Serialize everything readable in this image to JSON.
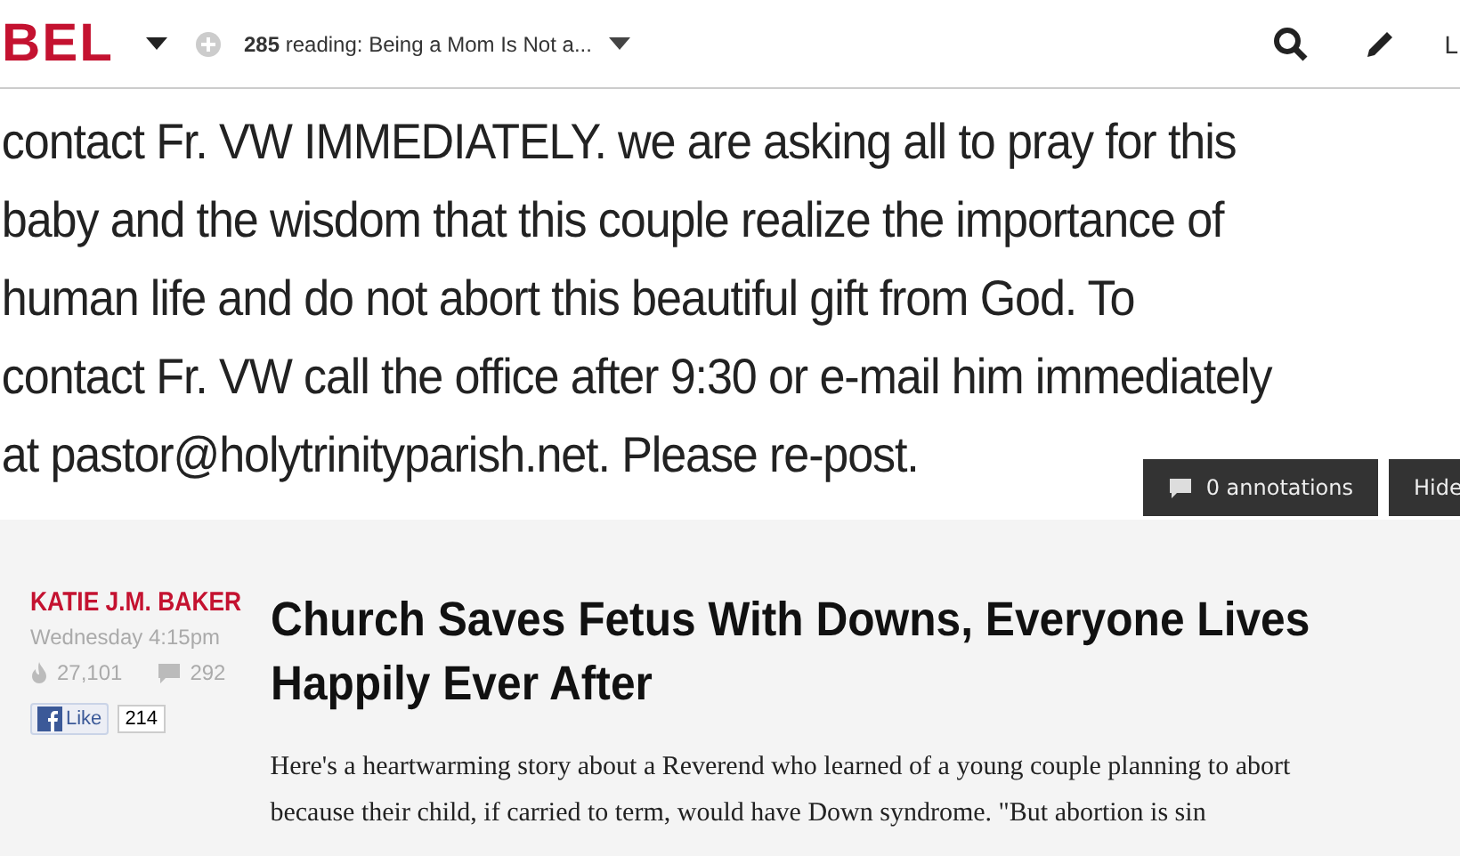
{
  "header": {
    "logo": "BEL",
    "reading_count": "285",
    "reading_text": "reading: Being a Mom Is Not a...",
    "login": "L"
  },
  "image_text": {
    "lines": [
      "contact Fr. VW IMMEDIATELY. we are asking all to pray for this",
      "baby and the wisdom that this couple realize the importance of",
      "human life and do not abort this beautiful gift from God. To",
      "contact Fr. VW call the office after 9:30 or e-mail him immediately",
      "at pastor@holytrinityparish.net. Please re-post."
    ]
  },
  "annotations": {
    "count_label": "0 annotations",
    "hide_label": "Hide"
  },
  "author": {
    "name": "KATIE J.M. BAKER",
    "time": "Wednesday 4:15pm",
    "views": "27,101",
    "comments": "292",
    "like_label": "Like",
    "like_count": "214"
  },
  "article": {
    "title": "Church Saves Fetus With Downs, Everyone Lives Happily Ever After",
    "body": "Here's a heartwarming story about a Reverend who learned of a young couple planning to abort because their child, if carried to term, would have Down syndrome. \"But abortion is sin"
  }
}
